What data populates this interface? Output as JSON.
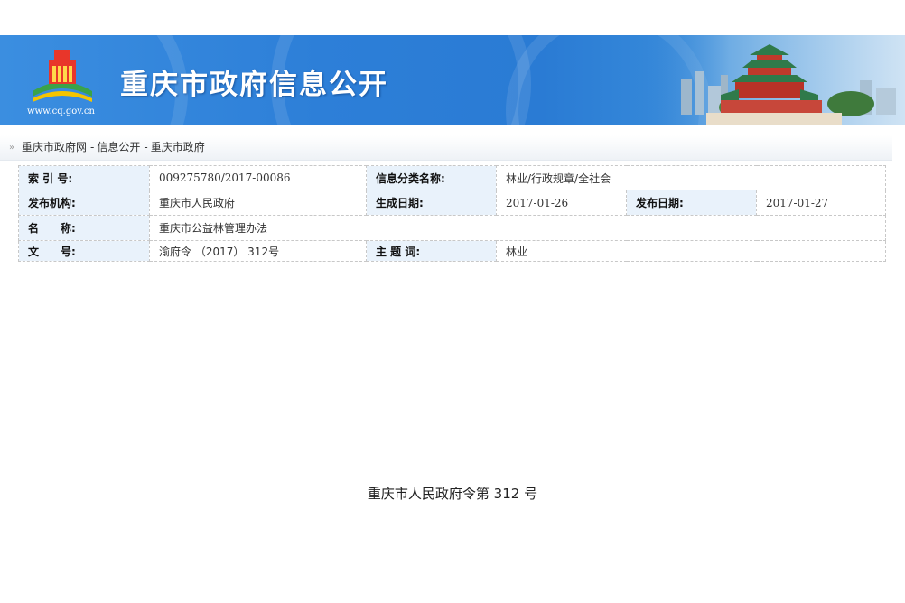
{
  "banner": {
    "title": "重庆市政府信息公开",
    "domain": "www.cq.gov.cn",
    "logo_icon": "cq-gov-emblem-icon",
    "hall_image": "great-hall-illustration",
    "colors": {
      "banner_blue": "#2d7fd8",
      "label_bg": "#e9f2fb"
    }
  },
  "breadcrumb": {
    "arrow_icon": "double-chevron-right-icon",
    "items": [
      "重庆市政府网",
      "信息公开",
      "重庆市政府"
    ],
    "separator": "-"
  },
  "info": {
    "index_label": "索 引 号:",
    "index_value": "009275780/2017-00086",
    "category_label": "信息分类名称:",
    "category_value": "林业/行政规章/全社会",
    "publisher_label": "发布机构:",
    "publisher_value": "重庆市人民政府",
    "generated_label": "生成日期:",
    "generated_value": "2017-01-26",
    "published_label": "发布日期:",
    "published_value": "2017-01-27",
    "name_label": "名　　称:",
    "name_value": "重庆市公益林管理办法",
    "docno_label": "文　　号:",
    "docno_value": "渝府令 （2017） 312号",
    "keyword_label": "主 题 词:",
    "keyword_value": "林业"
  },
  "document": {
    "order_heading": "重庆市人民政府令第  312 号"
  }
}
